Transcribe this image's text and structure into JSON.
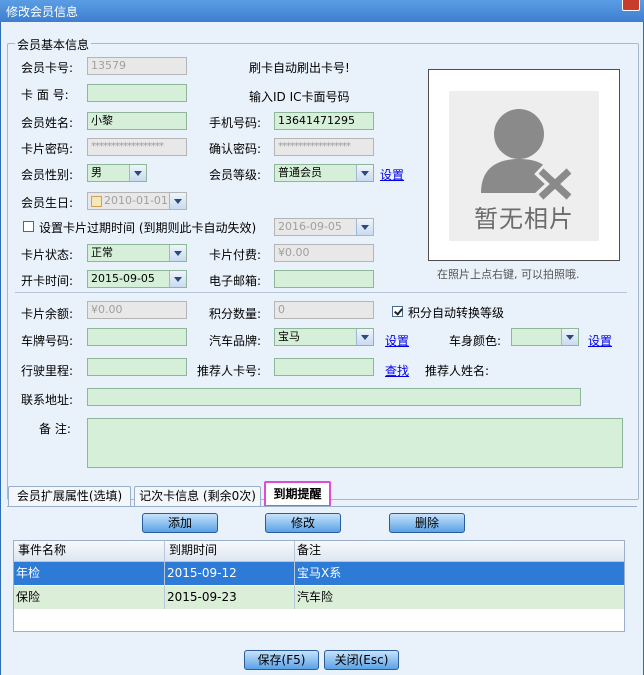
{
  "window": {
    "title": "修改会员信息"
  },
  "basic": {
    "legend": "会员基本信息",
    "card_no_label": "会员卡号:",
    "card_no_value": "13579",
    "card_no_hint": "刷卡自动刷出卡号!",
    "card_face_label": "卡 面 号:",
    "card_face_value": "",
    "card_face_hint": "输入ID IC卡面号码",
    "name_label": "会员姓名:",
    "name_value": "小黎",
    "phone_label": "手机号码:",
    "phone_value": "13641471295",
    "pwd_label": "卡片密码:",
    "pwd_value": "******************",
    "pwd_confirm_label": "确认密码:",
    "pwd_confirm_value": "******************",
    "gender_label": "会员性别:",
    "gender_value": "男",
    "level_label": "会员等级:",
    "level_value": "普通会员",
    "level_link": "设置",
    "birthday_label": "会员生日:",
    "birthday_value": "2010-01-01",
    "expire_label": "设置卡片过期时间 (到期则此卡自动失效)",
    "expire_value": "2016-09-05",
    "status_label": "卡片状态:",
    "status_value": "正常",
    "fee_label": "卡片付费:",
    "fee_value": "¥0.00",
    "open_label": "开卡时间:",
    "open_value": "2015-09-05",
    "email_label": "电子邮箱:",
    "email_value": "",
    "photo_text": "暂无相片",
    "photo_hint": "在照片上点右键, 可以拍照哦.",
    "balance_label": "卡片余额:",
    "balance_value": "¥0.00",
    "points_label": "积分数量:",
    "points_value": "0",
    "auto_level_label": "积分自动转换等级",
    "auto_level_checked": true,
    "plate_label": "车牌号码:",
    "plate_value": "",
    "brand_label": "汽车品牌:",
    "brand_value": "宝马",
    "brand_link": "设置",
    "color_label": "车身颜色:",
    "color_value": "",
    "color_link": "设置",
    "mileage_label": "行驶里程:",
    "mileage_value": "",
    "referrer_label": "推荐人卡号:",
    "referrer_value": "",
    "referrer_link": "查找",
    "referrer_name_label": "推荐人姓名:",
    "address_label": "联系地址:",
    "address_value": "",
    "note_label": "备 注:",
    "note_value": ""
  },
  "tabs": [
    {
      "label": "会员扩展属性(选填)"
    },
    {
      "label": "记次卡信息 (剩余0次)"
    },
    {
      "label": "到期提醒"
    }
  ],
  "reminder": {
    "add": "添加",
    "edit": "修改",
    "delete": "删除",
    "columns": [
      "事件名称",
      "到期时间",
      "备注"
    ],
    "rows": [
      {
        "event": "年检",
        "date": "2015-09-12",
        "note": "宝马X系"
      },
      {
        "event": "保险",
        "date": "2015-09-23",
        "note": "汽车险"
      }
    ],
    "selected_color": "#2d7ad7"
  },
  "footer": {
    "save": "保存(F5)",
    "close": "关闭(Esc)"
  }
}
